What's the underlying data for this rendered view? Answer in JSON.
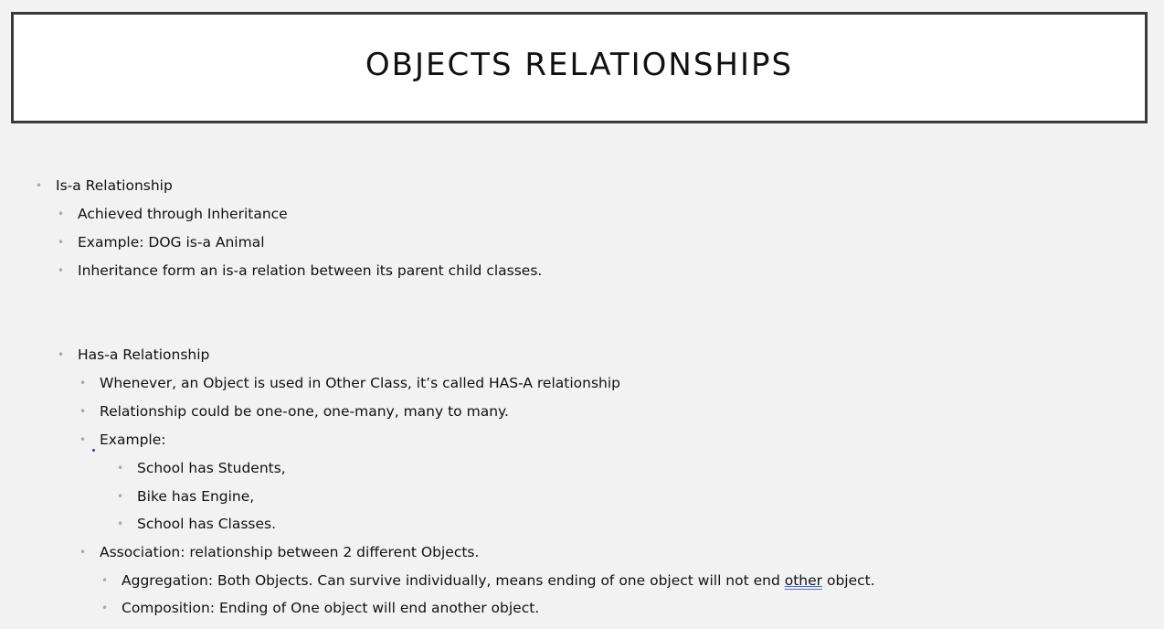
{
  "title": "OBJECTS RELATIONSHIPS",
  "bullets": {
    "is_a": "Is-a Relationship",
    "achieved": "Achieved through Inheritance",
    "example_dog": "Example: DOG is-a Animal",
    "inheritance_form": "Inheritance form an is-a relation between its parent child classes.",
    "has_a": "Has-a Relationship",
    "whenever": "Whenever, an Object is used in Other Class, it’s called HAS-A relationship",
    "relationship_could": "Relationship could be one-one, one-many, many to many.",
    "example": "Example:",
    "school_students": "School has Students,",
    "bike_engine": "Bike has Engine,",
    "school_classes": "School has Classes.",
    "association": "Association: relationship between 2 different Objects.",
    "aggregation_prefix": "Aggregation:  Both Objects. Can survive individually, means ending of one object will not end ",
    "aggregation_underlined": "other",
    "aggregation_suffix": " object.",
    "composition": "Composition: Ending of One object will end another object."
  },
  "bullet_glyph": "•"
}
